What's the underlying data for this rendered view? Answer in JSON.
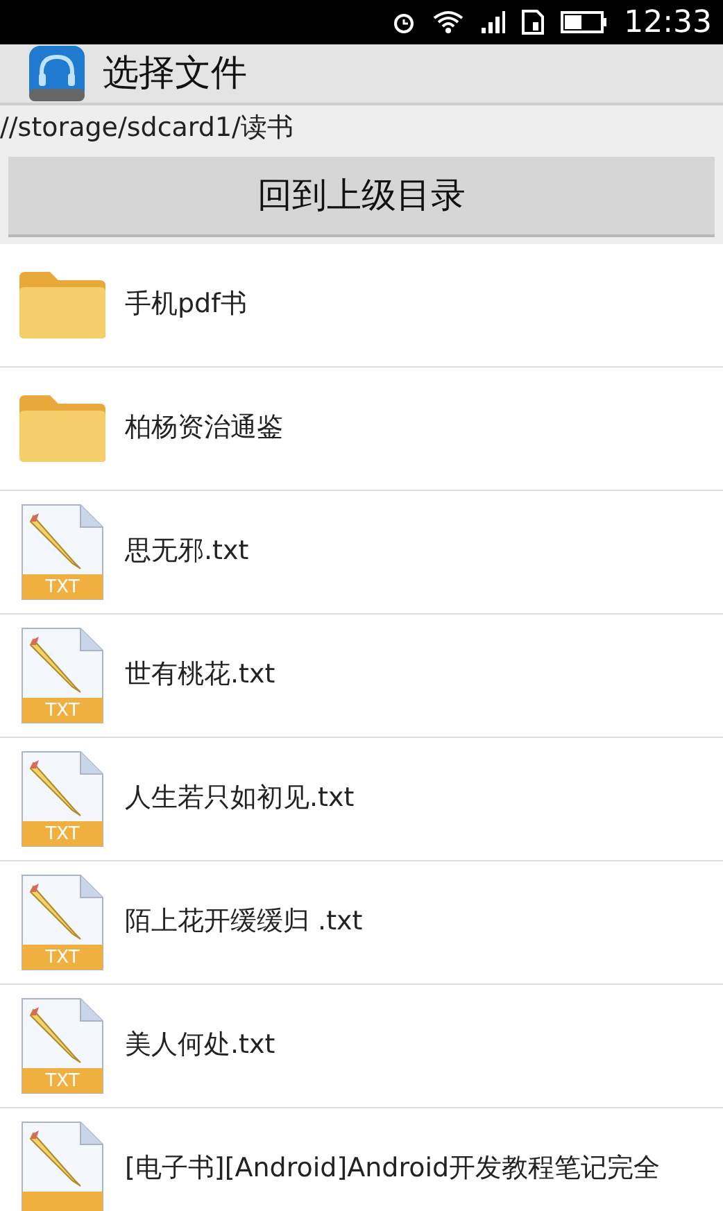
{
  "status_bar": {
    "time": "12:33"
  },
  "app_bar": {
    "title": "选择文件"
  },
  "path": "//storage/sdcard1/读书",
  "up_button": "回到上级目录",
  "files": [
    {
      "kind": "folder",
      "name": "手机pdf书"
    },
    {
      "kind": "folder",
      "name": "柏杨资治通鉴"
    },
    {
      "kind": "txt",
      "name": "思无邪.txt",
      "icon_label": "TXT"
    },
    {
      "kind": "txt",
      "name": "世有桃花.txt",
      "icon_label": "TXT"
    },
    {
      "kind": "txt",
      "name": "人生若只如初见.txt",
      "icon_label": "TXT"
    },
    {
      "kind": "txt",
      "name": "陌上花开缓缓归 .txt",
      "icon_label": "TXT"
    },
    {
      "kind": "txt",
      "name": "美人何处.txt",
      "icon_label": "TXT"
    },
    {
      "kind": "txt",
      "name": "[电子书][Android]Android开发教程笔记完全"
    }
  ]
}
